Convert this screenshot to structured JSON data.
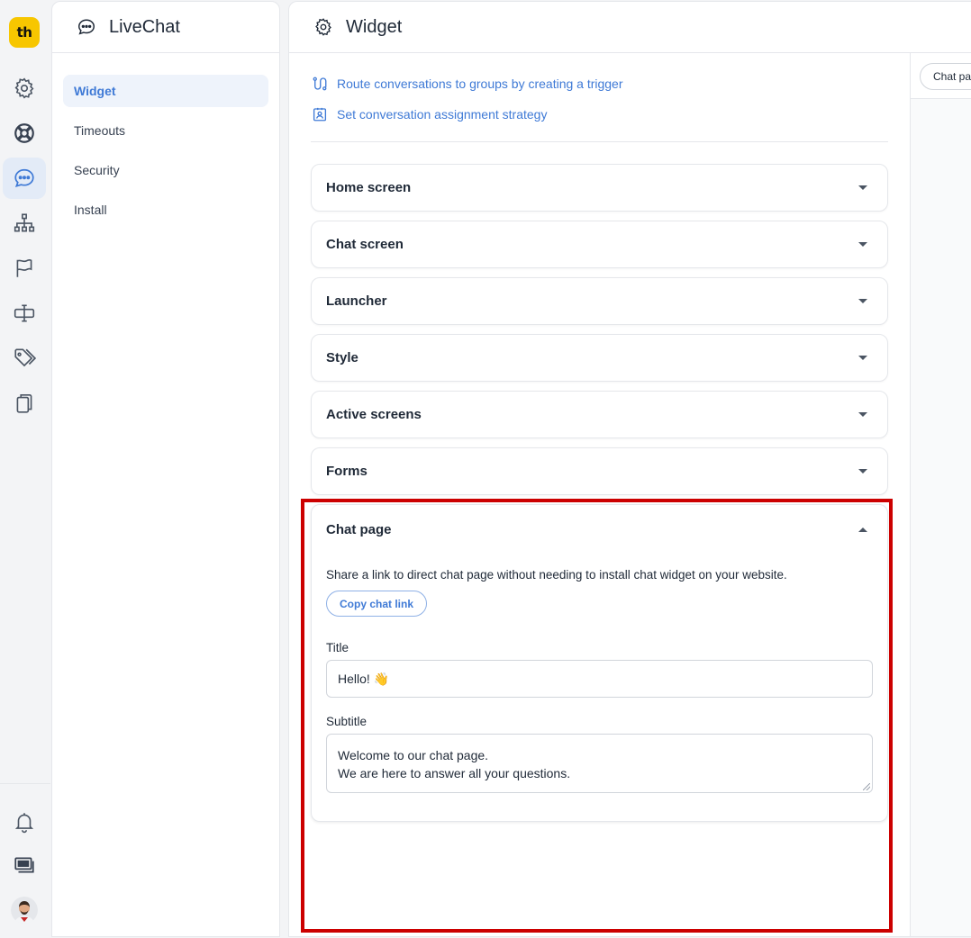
{
  "app": {
    "logo_text": "th",
    "brand_color": "#f7c600",
    "accent_color": "#3f7ad6",
    "highlight_color": "#cc0000"
  },
  "rail": {
    "items": [
      {
        "icon": "gear-icon"
      },
      {
        "icon": "lifebuoy-icon"
      },
      {
        "icon": "chat-icon",
        "active": true
      },
      {
        "icon": "org-chart-icon"
      },
      {
        "icon": "flag-icon"
      },
      {
        "icon": "text-cursor-icon"
      },
      {
        "icon": "tags-icon"
      },
      {
        "icon": "copy-icon"
      }
    ],
    "bottom_items": [
      {
        "icon": "bell-icon"
      },
      {
        "icon": "billing-icon"
      },
      {
        "icon": "avatar"
      }
    ]
  },
  "sidebar": {
    "title": "LiveChat",
    "items": [
      {
        "label": "Widget",
        "active": true
      },
      {
        "label": "Timeouts"
      },
      {
        "label": "Security"
      },
      {
        "label": "Install"
      }
    ]
  },
  "main": {
    "title": "Widget",
    "links": [
      {
        "label": "Route conversations to groups by creating a trigger",
        "icon": "route-icon"
      },
      {
        "label": "Set conversation assignment strategy",
        "icon": "assignment-icon"
      }
    ],
    "sections": [
      {
        "label": "Home screen"
      },
      {
        "label": "Chat screen"
      },
      {
        "label": "Launcher"
      },
      {
        "label": "Style"
      },
      {
        "label": "Active screens"
      },
      {
        "label": "Forms"
      }
    ],
    "chat_page": {
      "label": "Chat page",
      "description": "Share a link to direct chat page without needing to install chat widget on your website.",
      "copy_button": "Copy chat link",
      "title_label": "Title",
      "title_value": "Hello! 👋",
      "subtitle_label": "Subtitle",
      "subtitle_line1": "Welcome to our chat page.",
      "subtitle_line2": "We are here to answer all your questions."
    }
  },
  "preview": {
    "chip_label": "Chat page"
  }
}
